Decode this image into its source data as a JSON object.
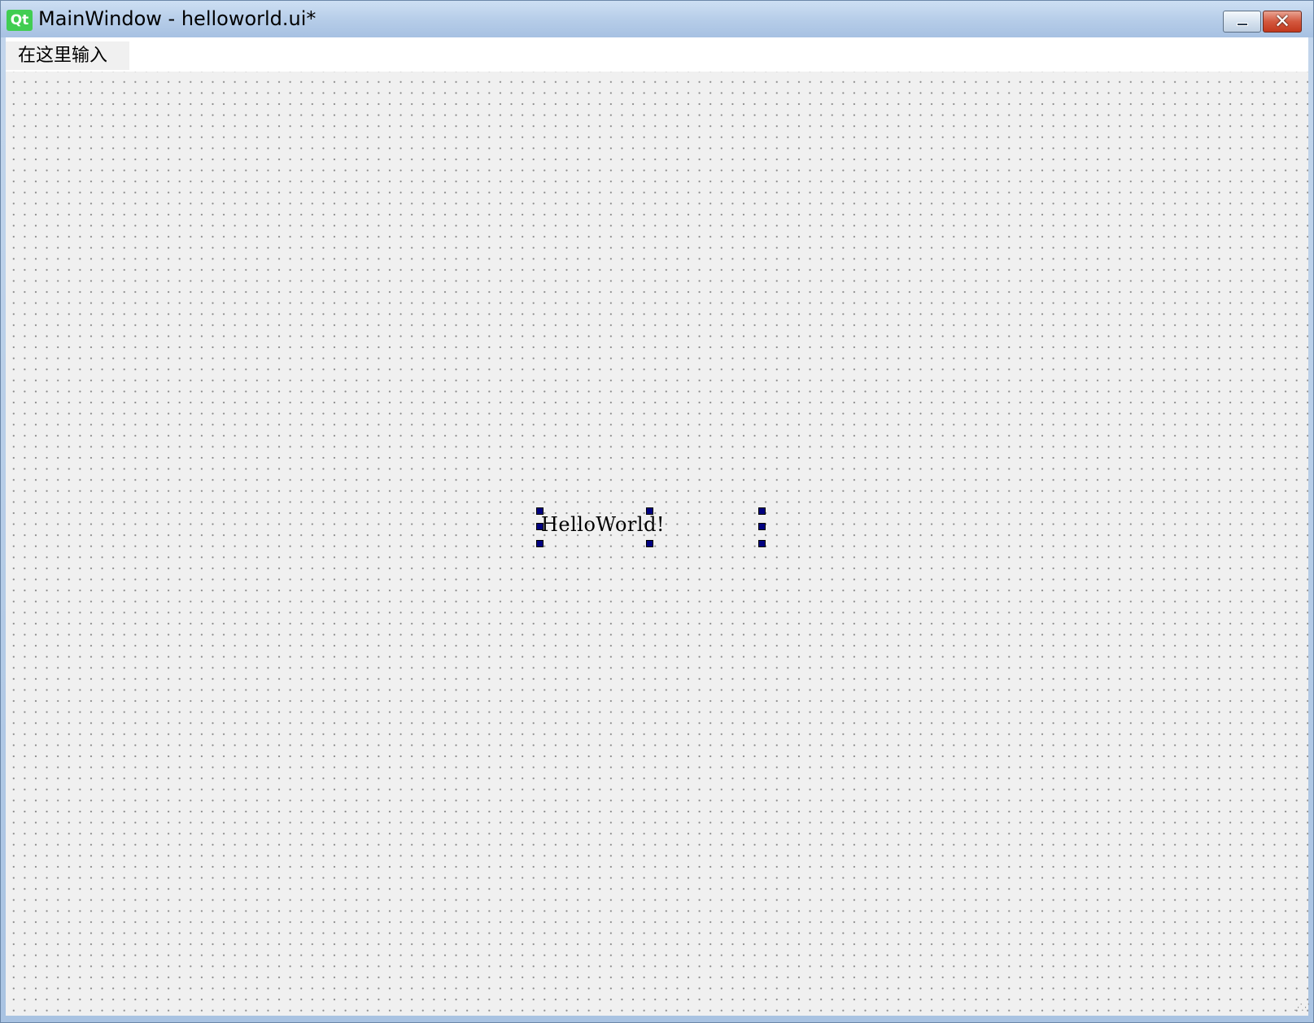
{
  "window": {
    "title": "MainWindow - helloworld.ui*",
    "app_icon_label": "Qt",
    "controls": {
      "minimize_icon": "minimize-icon",
      "close_icon": "close-icon",
      "close_glyph": "✕"
    }
  },
  "menubar": {
    "items": [
      {
        "label": "在这里输入"
      }
    ]
  },
  "form": {
    "grid": "dotted",
    "widgets": [
      {
        "type": "QLabel",
        "text": "HelloWorld!",
        "selected": true
      }
    ]
  },
  "colors": {
    "qt_green": "#41cd52",
    "selection_handle": "#000080",
    "client_background": "#f0f0f0",
    "close_button": "#c2381d"
  }
}
